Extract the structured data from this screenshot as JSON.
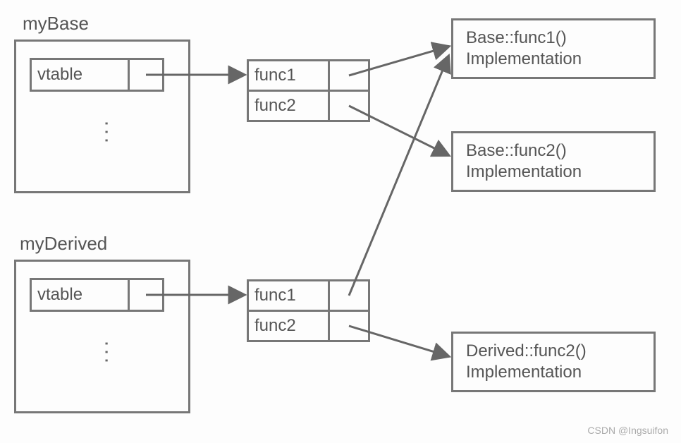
{
  "labels": {
    "base": "myBase",
    "derived": "myDerived",
    "vtable": "vtable",
    "func1": "func1",
    "func2": "func2"
  },
  "impl": {
    "base_func1_line1": "Base::func1()",
    "base_func1_line2": "Implementation",
    "base_func2_line1": "Base::func2()",
    "base_func2_line2": "Implementation",
    "derived_func2_line1": "Derived::func2()",
    "derived_func2_line2": "Implementation"
  },
  "watermark": "CSDN @Ingsuifon"
}
